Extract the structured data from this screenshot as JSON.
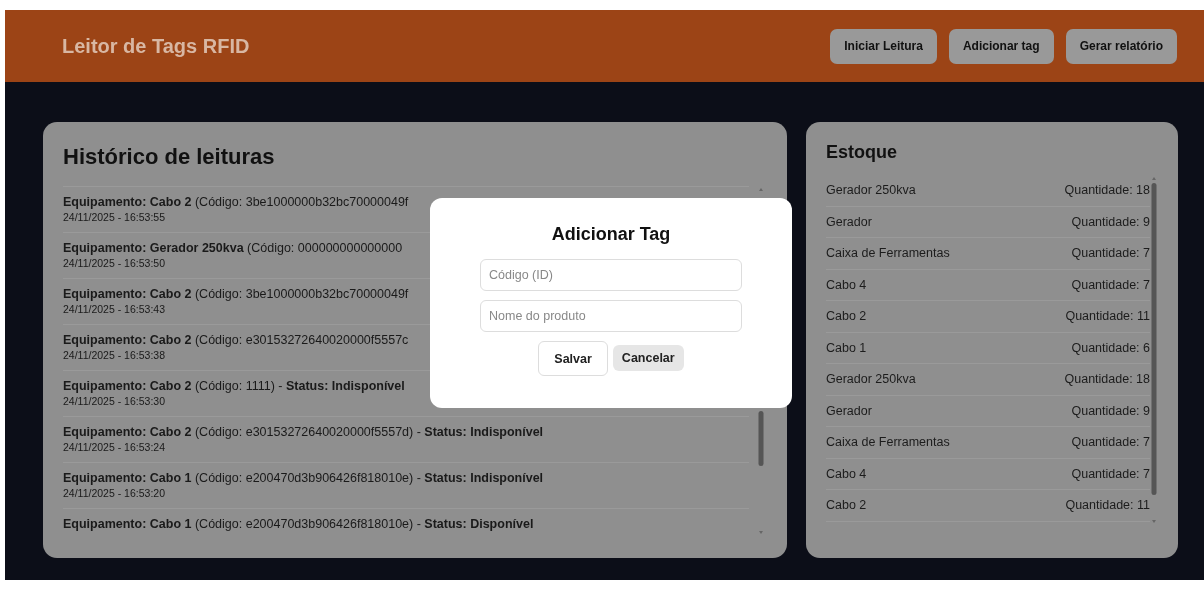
{
  "header": {
    "title": "Leitor de Tags RFID",
    "buttons": [
      "Iniciar Leitura",
      "Adicionar tag",
      "Gerar relatório"
    ]
  },
  "history": {
    "title": "Histórico de leituras",
    "entries": [
      {
        "text": "**Equipamento: Cabo 2** (Código: 3be1000000b32bc70000049f",
        "time": "24/11/2025 - 16:53:55"
      },
      {
        "text": "**Equipamento: Gerador 250kva** (Código: 000000000000000",
        "time": "24/11/2025 - 16:53:50"
      },
      {
        "text": "**Equipamento: Cabo 2** (Código: 3be1000000b32bc70000049f",
        "time": "24/11/2025 - 16:53:43"
      },
      {
        "text": "**Equipamento: Cabo 2** (Código: e30153272640020000f5557c",
        "time": "24/11/2025 - 16:53:38"
      },
      {
        "text": "**Equipamento: Cabo 2** (Código: 1111) - **Status: Indisponível**",
        "time": "24/11/2025 - 16:53:30"
      },
      {
        "text": "**Equipamento: Cabo 2** (Código: e30153272640020000f5557d) - **Status: Indisponível**",
        "time": "24/11/2025 - 16:53:24"
      },
      {
        "text": "**Equipamento: Cabo 1** (Código: e200470d3b906426f818010e) - **Status: Indisponível**",
        "time": "24/11/2025 - 16:53:20"
      },
      {
        "text": "**Equipamento: Cabo 1** (Código: e200470d3b906426f818010e) - **Status: Disponível**"
      }
    ]
  },
  "stock": {
    "title": "Estoque",
    "items": [
      {
        "name": "Gerador 250kva",
        "quantity": "Quantidade: 18"
      },
      {
        "name": "Gerador",
        "quantity": "Quantidade: 9"
      },
      {
        "name": "Caixa de Ferramentas",
        "quantity": "Quantidade: 7"
      },
      {
        "name": "Cabo 4",
        "quantity": "Quantidade: 7"
      },
      {
        "name": "Cabo 2",
        "quantity": "Quantidade: 11"
      },
      {
        "name": "Cabo 1",
        "quantity": "Quantidade: 6"
      },
      {
        "name": "Gerador 250kva",
        "quantity": "Quantidade: 18"
      },
      {
        "name": "Gerador",
        "quantity": "Quantidade: 9"
      },
      {
        "name": "Caixa de Ferramentas",
        "quantity": "Quantidade: 7"
      },
      {
        "name": "Cabo 4",
        "quantity": "Quantidade: 7"
      },
      {
        "name": "Cabo 2",
        "quantity": "Quantidade: 11"
      }
    ]
  },
  "modal": {
    "title": "Adicionar Tag",
    "fields": [
      {
        "placeholder": "Código (ID)"
      },
      {
        "placeholder": "Nome do produto"
      }
    ],
    "buttons": [
      {
        "label": "Salvar",
        "kind": "outlined"
      },
      {
        "label": "Cancelar",
        "kind": "filled"
      }
    ]
  }
}
